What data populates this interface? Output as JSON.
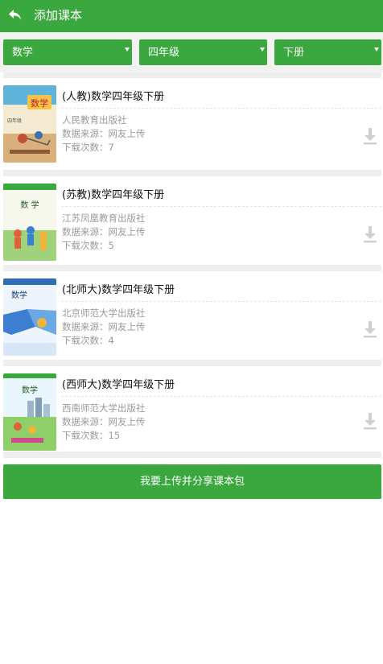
{
  "header": {
    "title": "添加课本",
    "back_icon": "back-arrow-icon",
    "bg_color": "#3aa83e"
  },
  "filters": [
    {
      "value": "数学"
    },
    {
      "value": "四年级"
    },
    {
      "value": "下册"
    }
  ],
  "books": [
    {
      "title": "(人教)数学四年级下册",
      "publisher": "人民教育出版社",
      "source": "数据来源：网友上传",
      "downloads": "下载次数：7",
      "cover_text": "数学",
      "cover_sub": "四年级"
    },
    {
      "title": "(苏教)数学四年级下册",
      "publisher": "江苏凤凰教育出版社",
      "source": "数据来源：网友上传",
      "downloads": "下载次数：5",
      "cover_text": "数 学"
    },
    {
      "title": "(北师大)数学四年级下册",
      "publisher": "北京师范大学出版社",
      "source": "数据来源：网友上传",
      "downloads": "下载次数：4",
      "cover_text": "数学"
    },
    {
      "title": "(西师大)数学四年级下册",
      "publisher": "西南师范大学出版社",
      "source": "数据来源：网友上传",
      "downloads": "下载次数：15",
      "cover_text": "数学"
    }
  ],
  "upload_button": {
    "label": "我要上传并分享课本包"
  }
}
